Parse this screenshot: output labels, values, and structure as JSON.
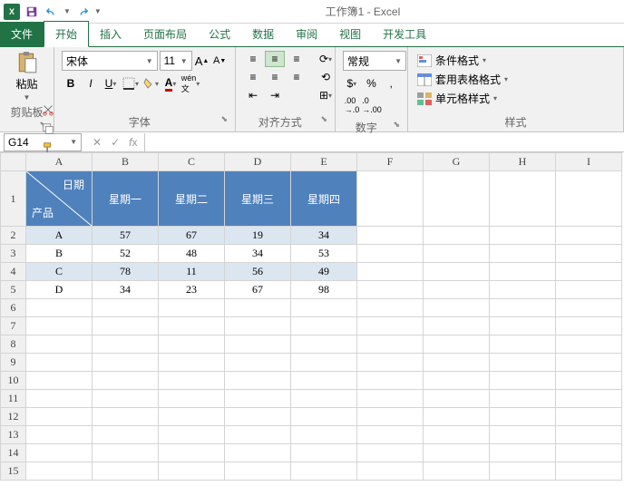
{
  "app": {
    "title": "工作簿1 - Excel"
  },
  "tabs": {
    "file": "文件",
    "home": "开始",
    "insert": "插入",
    "layout": "页面布局",
    "formula": "公式",
    "data": "数据",
    "review": "审阅",
    "view": "视图",
    "dev": "开发工具"
  },
  "ribbon": {
    "paste": "粘贴",
    "clipboard": "剪贴板",
    "font_name": "宋体",
    "font_size": "11",
    "font_label": "字体",
    "align_label": "对齐方式",
    "number_format": "常规",
    "number_label": "数字",
    "cond": "条件格式",
    "table": "套用表格格式",
    "cell": "单元格样式",
    "styles": "样式"
  },
  "fx": {
    "name_box": "G14"
  },
  "sheet": {
    "cols": [
      "A",
      "B",
      "C",
      "D",
      "E",
      "F",
      "G",
      "H",
      "I"
    ],
    "rows": [
      "1",
      "2",
      "3",
      "4",
      "5",
      "6",
      "7",
      "8",
      "9",
      "10",
      "11",
      "12",
      "13",
      "14",
      "15"
    ],
    "diag_top": "日期",
    "diag_bottom": "产品",
    "headers": [
      "星期一",
      "星期二",
      "星期三",
      "星期四"
    ],
    "data": [
      {
        "p": "A",
        "v": [
          "57",
          "67",
          "19",
          "34"
        ]
      },
      {
        "p": "B",
        "v": [
          "52",
          "48",
          "34",
          "53"
        ]
      },
      {
        "p": "C",
        "v": [
          "78",
          "11",
          "56",
          "49"
        ]
      },
      {
        "p": "D",
        "v": [
          "34",
          "23",
          "67",
          "98"
        ]
      }
    ]
  },
  "chart_data": {
    "type": "table",
    "title": "",
    "row_label": "产品",
    "col_label": "日期",
    "categories": [
      "星期一",
      "星期二",
      "星期三",
      "星期四"
    ],
    "series": [
      {
        "name": "A",
        "values": [
          57,
          67,
          19,
          34
        ]
      },
      {
        "name": "B",
        "values": [
          52,
          48,
          34,
          53
        ]
      },
      {
        "name": "C",
        "values": [
          78,
          11,
          56,
          49
        ]
      },
      {
        "name": "D",
        "values": [
          34,
          23,
          67,
          98
        ]
      }
    ]
  }
}
